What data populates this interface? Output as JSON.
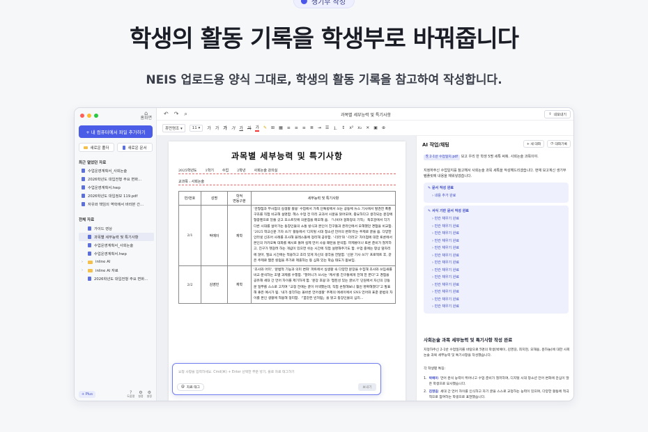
{
  "hero": {
    "badge": "생기부 작성",
    "title": "학생의 활동 기록을 학생부로 바꿔줍니다",
    "subtitle": "NEIS 업로드용 양식 그대로, 학생의 활동 기록을 참고하여 작성합니다."
  },
  "sidebar": {
    "home_label": "홈화면",
    "upload_button": "+ 내 컴퓨터에서 파일 추가하기",
    "new_folder": "새로운 폴더",
    "new_doc": "새로운 문서",
    "recent_title": "최근 열었던 자료",
    "recent": [
      "수업운영계획서_사회논술",
      "2026학년도 대입전형 주요 변화...",
      "수업운영계획서.hwp",
      "2026학년도 대입정보 119.pdf",
      "자유와 책임의 역학에서 바라본 간..."
    ],
    "all_title": "전체 자료",
    "all": [
      {
        "label": "가이드 영상",
        "kind": "doc",
        "selected": false
      },
      {
        "label": "과목별 세부능력 및 특기사항",
        "kind": "doc",
        "selected": true
      },
      {
        "label": "수업운영계획서_사회논술",
        "kind": "doc",
        "selected": false
      },
      {
        "label": "수업운영계획서.hwp",
        "kind": "doc",
        "selected": false
      },
      {
        "label": "inline AI",
        "kind": "folder",
        "selected": false
      },
      {
        "label": "inline AI 자료",
        "kind": "folder",
        "selected": false
      },
      {
        "label": "2026학년도 대입전형 주요 변화...",
        "kind": "doc",
        "selected": false
      }
    ],
    "plus": "+ Plus",
    "bottom_icons": [
      "도움말",
      "설정",
      "설정"
    ]
  },
  "titlebar": {
    "doc_title": "과목별 세부능력 및 특기사항",
    "export": "내보내기"
  },
  "toolbar": {
    "font": "휴먼명조",
    "size": "11",
    "items": [
      "가",
      "가",
      "가",
      "가",
      "가",
      "가",
      "가"
    ]
  },
  "document": {
    "title": "과목별 세부능력 및 특기사항",
    "meta": [
      "2025학년도",
      "1학기",
      "수업",
      "2학년",
      "사회논술 강의실"
    ],
    "subject": "교과목 : 사회논술",
    "headers": [
      "반/번호",
      "성명",
      "학적\n변동구분",
      "세부능력 및 특기사항"
    ],
    "rows": [
      {
        "num": "2/1",
        "name": "박예이",
        "status": "재학",
        "text": "'관형점과 무사점의 실생활 활용' 수업에서 가족 단톡방에서 쓰는 공동체 뉴스 기사에서 발견한 폭풍 구조를 직접 비교해 설명함. 헤스 수업 전 미리 교과서 시문을 읽어오며, 중요하다고 생각되는 문장에 형광펜으로 밑줄 긋고 포스트잇에 의문점을 메모해 옴. 『나비야 걸화정의 기적』 독후감에서 각기 다른 시대를 살아가는 동창인물의 소통 방식과 본인이 친구들과 온라인에서 오해했던 경험을 비교함. '2025 학교신문 기자 쓰기' 활동에서 '디지털 시대 청소년 언어의 변화'라는 주제로 글을 씀. 다양한 인터넷 신조어 사례를 조사해 블레스들에 정리해 공유함. '-더라'와 '-더라고' 차이점에 대한 토론에서 본인의 카카오톡 대화를 예시로 들며 실제 언어 사용 패턴을 분석함. 파제롱이나 토론 준비가 철저하고, 친구가 헷갈려 하는 개념이 있으면 쉬는 시간에 직접 설명해주기도 함. 수업 중에는 항상 앞자리에 앉아, 필요 시간에는 적용하고 조리 있게 자신의 생각을 전달함. '신문 기사 쓰기' 프로젝트 후, 같은 주제로 짧은 칼럼을 추가로 제출하는 등 심화 있는 학습 태도가 돋보임."
      },
      {
        "num": "2/2",
        "name": "김영민",
        "status": "재학",
        "text": "'조사와 어미', '문법적 기능과 의미 변화' 파트에서 실생활 속 다양한 문장을 수집해 조사와 쓰임새를 비교·분석하는 조별 과제를 수행함. \"할머니가 쓰시는 '께서'를 친구들에게 전해 한 폰다\"고 경험을 공유해 세대 간 언어 차이를 제기하게 함. '문장 호응'과 '접된성 있는 글쓰기' 단원에서 자신의 강동문 일부를 스스로 고치며 \"교정 전에는 글이 어색했는데, 직접 손질해보니 훨씬 명확해졌다\"고 발표해 좋은 예시가 됨. '내가 생각하는 올바른 언어생활' 주제의 에세이에서 SNS 언어와 표준 문법의 차이를 본인 생활에 적용해 정리함. 「꿈같은 빈처럼」을 읽고 등장인물의 심리..."
      }
    ]
  },
  "chat": {
    "placeholder": "요청 사항을 입력하세요. Cmd(⌘) + Enter 선택한 부분 넣기, 블로 자료 태그하기",
    "ref_label": "자료 태그",
    "send": "보내기"
  },
  "ai_panel": {
    "title": "AI 작업/채팅",
    "new_chat": "+ 새 대화",
    "history": "대화기록",
    "file_tag": "2-1반 수업일지.pdf",
    "user_msg": "보고 우리 반 학생 5명 세특 써줘. 사회논술 과목이야.",
    "assistant_intro": "지정하주신 수업일지를 참고해서 사회논술 과목 세특을 작성해드리겠습니다. 현재 보고계신 생기부 템플릿에 내용을 채워넣겠습니다.",
    "box1_title": "문서 작성 완료",
    "box1_items": [
      "내용 추가 완료"
    ],
    "box2_title": "서식 기반 문서 작성 완료",
    "box2_items": [
      "빈칸 채우기 완료",
      "빈칸 채우기 완료",
      "빈칸 채우기 완료",
      "빈칸 채우기 완료",
      "빈칸 채우기 완료",
      "빈칸 채우기 완료",
      "빈칸 채우기 완료",
      "빈칸 채우기 완료",
      "빈칸 채우기 완료",
      "빈칸 채우기 완료",
      "빈칸 채우기 완료",
      "빈칸 채우기 완료",
      "빈칸 채우기 완료"
    ],
    "result_title": "사회논술 과목 세부능력 및 특기사항 작성 완료",
    "result_desc": "지정하주신 2-1반 수업일지를 바탕으로 5명의 학생(박예이, 김영길, 최지현, 오해용, 윤하늘)에 대한 사회논술 과목 세부능력 및 특기사항을 작성했습니다.",
    "features_title": "각 학생별 특징:",
    "features": [
      {
        "name": "박예이",
        "text": ": 언어 분석 능력이 뛰어나고 수업 준비가 철저하며, 디지털 시대 청소년 언어 변화에 관심이 많은 학생으로 묘사했습니다."
      },
      {
        "name": "김영길",
        "text": ": 세대 간 언어 차이를 인식하고 자기 글을 스스로 교정하는 능력이 있으며, 다양한 활동에 적극적으로 참여하는 학생으로 표현했습니다."
      },
      {
        "name": "최지현",
        "text": ": 꿈장 무엇의 역할과 중요성을 이해하고, 소설 분석과 토론 진행에 능숙하며, 논거의 신뢰성을 중시하는 학생으로 기술했습니다."
      },
      {
        "name": "오해용",
        "text": ": 가정에서의 언어습관 변화에 관심이 많고, 자기 성찰적 태도가 돋보이며, 솔직한 의견 개진으로 수업 분위기를 이끄는 학생으로 작성했습니다."
      },
      {
        "name": "윤하늘",
        "text": ": 표준어와 방언의 차이에 대한 탐구에 재능을 가진 학생으로 작성했습니다."
      }
    ]
  },
  "colors": {
    "accent": "#4b5ce6",
    "selected": "#e8eaf6",
    "panel_box": "#eef1fd"
  }
}
